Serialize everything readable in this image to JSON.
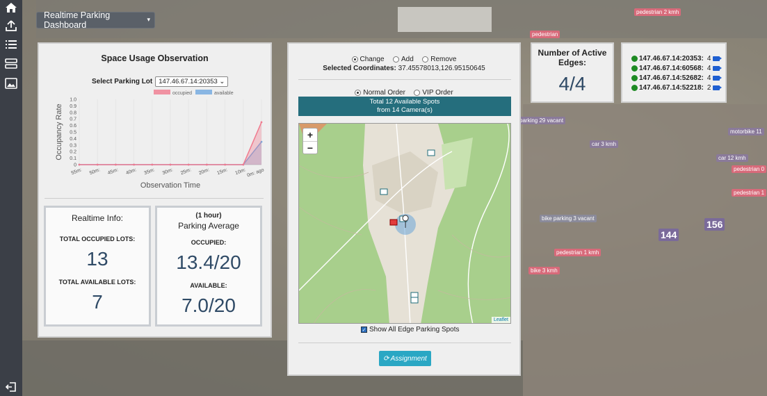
{
  "app": {
    "dashboard_button": "Realtime Parking Dashboard"
  },
  "sidebar": {
    "items": [
      "home-icon",
      "upload-icon",
      "list-icon",
      "server-icon",
      "image-gallery-icon"
    ],
    "bottom": "logout-icon"
  },
  "background_labels": [
    "pedestrian 2 kmh",
    "pedestrian",
    "parking 29 vacant",
    "car 3 kmh",
    "car 12 kmh",
    "pedestrian 0",
    "pedestrian 1",
    "motorbike 11",
    "bike parking 3 vacant",
    "pedestrian 1 kmh",
    "bike 3 kmh",
    "144",
    "156"
  ],
  "usage": {
    "title": "Space Usage Observation",
    "select_label": "Select Parking Lot",
    "select_value": "147.46.67.14:20353",
    "legend_occupied": "occupied",
    "legend_available": "available",
    "xlabel": "Observation Time",
    "ylabel": "Occupancy Rate"
  },
  "chart_data": {
    "type": "area",
    "title": "",
    "xlabel": "Observation Time",
    "ylabel": "Occupancy Rate",
    "ylim": [
      0,
      1.0
    ],
    "yticks": [
      "0",
      "0.1",
      "0.2",
      "0.3",
      "0.4",
      "0.5",
      "0.6",
      "0.7",
      "0.8",
      "0.9",
      "1.0"
    ],
    "categories": [
      "55m:",
      "50m:",
      "45m:",
      "40m:",
      "35m:",
      "30m:",
      "25m:",
      "20m:",
      "15m:",
      "10m:",
      "0m: ago"
    ],
    "series": [
      {
        "name": "occupied",
        "color": "#f07a8e",
        "values": [
          0,
          0,
          0,
          0,
          0,
          0,
          0,
          0,
          0,
          0,
          0.65
        ]
      },
      {
        "name": "available",
        "color": "#6fa8e0",
        "values": [
          0,
          0,
          0,
          0,
          0,
          0,
          0,
          0,
          0,
          0,
          0.35
        ]
      }
    ],
    "grid": true,
    "legend": "top"
  },
  "realtime": {
    "title": "Realtime Info:",
    "occupied_label": "TOTAL OCCUPIED LOTS:",
    "occupied_value": "13",
    "available_label": "TOTAL AVAILABLE LOTS:",
    "available_value": "7"
  },
  "average": {
    "subtitle": "(1 hour)",
    "title": "Parking Average",
    "occupied_label": "OCCUPIED:",
    "occupied_value": "13.4/20",
    "available_label": "AVAILABLE:",
    "available_value": "7.0/20"
  },
  "mid": {
    "modes": [
      "Change",
      "Add",
      "Remove"
    ],
    "selected_mode": "Change",
    "coords_label": "Selected Coordinates:",
    "coords_value": "37.45578013,126.95150645",
    "orders": [
      "Normal Order",
      "VIP Order"
    ],
    "selected_order": "Normal Order",
    "banner_line1": "Total 12 Available Spots",
    "banner_line2": "from 14 Camera(s)",
    "zoom_in": "+",
    "zoom_out": "−",
    "leaflet": "Leaflet",
    "show_all": "Show All Edge Parking Spots",
    "assign": "Assignment"
  },
  "edges": {
    "title": "Number of Active Edges:",
    "value": "4/4",
    "list": [
      {
        "addr": "147.46.67.14:20353:",
        "count": "4"
      },
      {
        "addr": "147.46.67.14:60568:",
        "count": "4"
      },
      {
        "addr": "147.46.67.14:52682:",
        "count": "4"
      },
      {
        "addr": "147.46.67.14:52218:",
        "count": "2"
      }
    ]
  }
}
